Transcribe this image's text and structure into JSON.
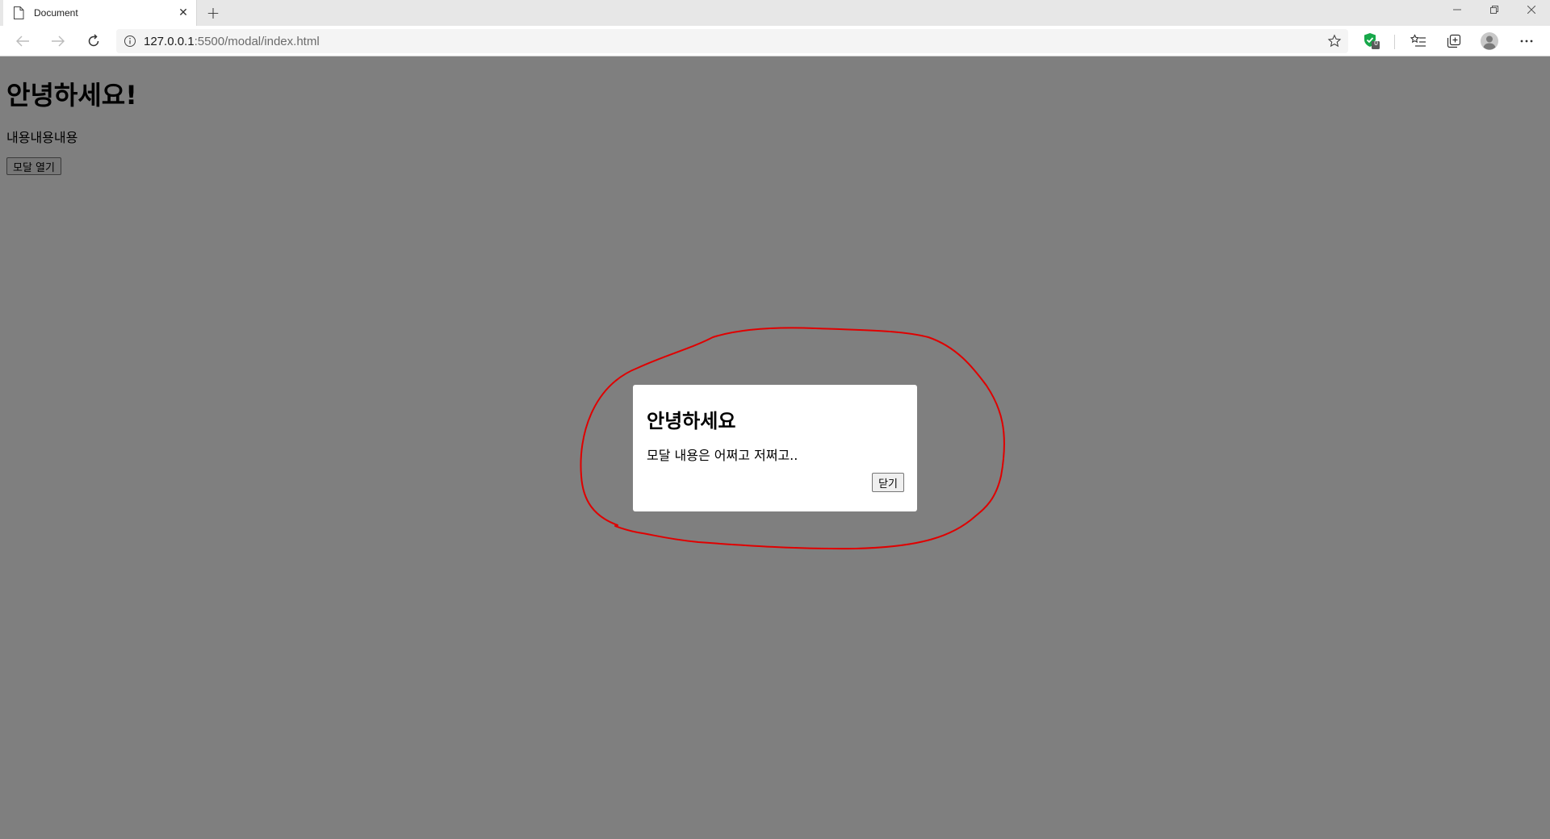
{
  "browser": {
    "tab_title": "Document",
    "tab_close": "✕",
    "new_tab": "+",
    "url_host": "127.0.0.1",
    "url_path": ":5500/modal/index.html",
    "extension_badge": "0",
    "window": {
      "minimize": "—",
      "restore": "❐",
      "close": "✕"
    }
  },
  "page": {
    "title": "안녕하세요!",
    "text": "내용내용내용",
    "open_modal_label": "모달 열기"
  },
  "modal": {
    "title": "안녕하세요",
    "text": "모달 내용은 어쩌고 저쩌고..",
    "close_label": "닫기"
  },
  "colors": {
    "overlay": "#808080",
    "annotation": "#e00000",
    "extension": "#17a84a"
  },
  "icons": {
    "tab": "page-icon",
    "back": "back-arrow-icon",
    "forward": "forward-arrow-icon",
    "refresh": "refresh-icon",
    "site_info": "info-icon",
    "favorite": "star-icon",
    "extension": "shield-check-icon",
    "favorites": "favorites-icon",
    "collections": "collections-icon",
    "profile": "profile-icon",
    "menu": "more-icon"
  }
}
